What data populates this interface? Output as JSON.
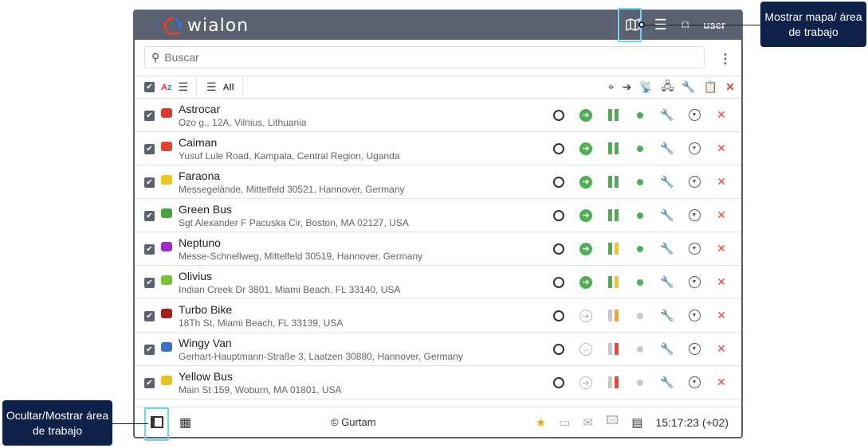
{
  "header": {
    "logo": "wialon",
    "user": "user"
  },
  "search": {
    "placeholder": "Buscar"
  },
  "units": [
    {
      "name": "Astrocar",
      "address": "Ozo g., 12A, Vilnius, Lithuania",
      "color": "#d83a2b",
      "moving": true,
      "state": "full"
    },
    {
      "name": "Caiman",
      "address": "Yusuf Lule Road, Kampala, Central Region, Uganda",
      "color": "#e0442a",
      "moving": true,
      "state": "full"
    },
    {
      "name": "Faraona",
      "address": "Messegelände, Mittelfeld 30521, Hannover, Germany",
      "color": "#f2c31a",
      "moving": true,
      "state": "full"
    },
    {
      "name": "Green Bus",
      "address": "Sgt Alexander F Pacuska Cir, Boston, MA 02127, USA",
      "color": "#49a33c",
      "moving": true,
      "state": "full"
    },
    {
      "name": "Neptuno",
      "address": "Messe-Schnellweg, Mittelfeld 30519, Hannover, Germany",
      "color": "#9b2fc4",
      "moving": true,
      "state": "partial"
    },
    {
      "name": "Olivius",
      "address": "Indian Creek Dr 3801, Miami Beach, FL 33140, USA",
      "color": "#77c23a",
      "moving": true,
      "state": "partial"
    },
    {
      "name": "Turbo Bike",
      "address": "18Th St, Miami Beach, FL 33139, USA",
      "color": "#a32020",
      "moving": false,
      "state": "orange"
    },
    {
      "name": "Wingy Van",
      "address": "Gerhart-Hauptmann-Straße 3, Laatzen 30880, Hannover, Germany",
      "color": "#3d6fc9",
      "moving": false,
      "state": "red",
      "stopped": true
    },
    {
      "name": "Yellow Bus",
      "address": "Main St 159, Woburn, MA 01801, USA",
      "color": "#e8c21c",
      "moving": false,
      "state": "red"
    }
  ],
  "footer": {
    "copyright": "© Gurtam",
    "time": "15:17:23 (+02)"
  },
  "callouts": {
    "map": "Mostrar mapa/ área de trabajo",
    "sidebar": "Ocultar/Mostrar área de trabajo"
  },
  "colors": {
    "header": "#5a6170",
    "accent": "#6fd3ea",
    "callout": "#0d2149",
    "green": "#4caf50",
    "red": "#f44336"
  }
}
